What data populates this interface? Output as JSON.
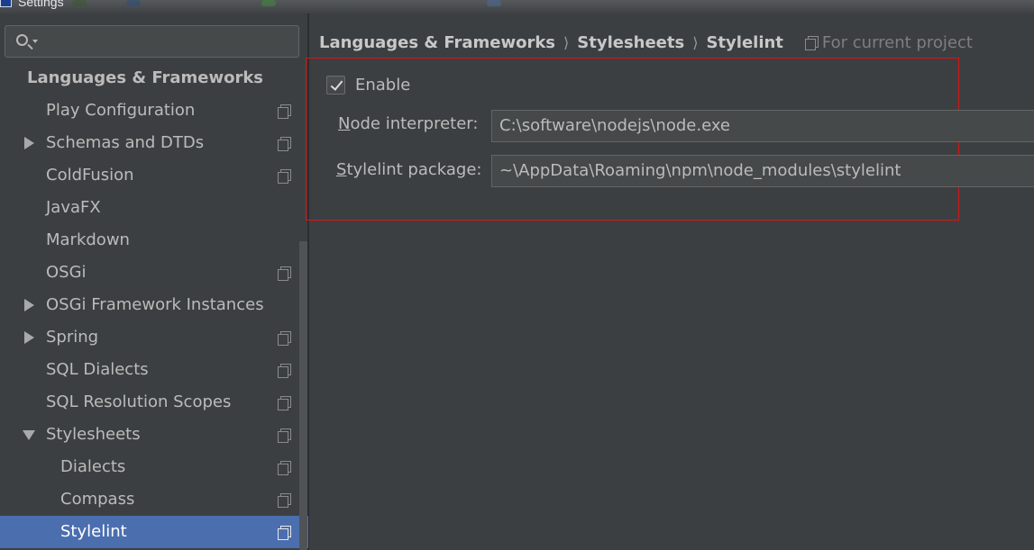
{
  "window": {
    "title": "Settings"
  },
  "search": {
    "value": ""
  },
  "sidebar": {
    "items": [
      {
        "label": "Languages & Frameworks",
        "arrow": "none",
        "project_icon": false
      },
      {
        "label": "Play Configuration",
        "arrow": "none",
        "project_icon": true
      },
      {
        "label": "Schemas and DTDs",
        "arrow": "right",
        "project_icon": true
      },
      {
        "label": "ColdFusion",
        "arrow": "none",
        "project_icon": true
      },
      {
        "label": "JavaFX",
        "arrow": "none",
        "project_icon": false
      },
      {
        "label": "Markdown",
        "arrow": "none",
        "project_icon": false
      },
      {
        "label": "OSGi",
        "arrow": "none",
        "project_icon": true
      },
      {
        "label": "OSGi Framework Instances",
        "arrow": "right",
        "project_icon": false
      },
      {
        "label": "Spring",
        "arrow": "right",
        "project_icon": true
      },
      {
        "label": "SQL Dialects",
        "arrow": "none",
        "project_icon": true
      },
      {
        "label": "SQL Resolution Scopes",
        "arrow": "none",
        "project_icon": true
      },
      {
        "label": "Stylesheets",
        "arrow": "down",
        "project_icon": true
      },
      {
        "label": "Dialects",
        "arrow": "none",
        "project_icon": true
      },
      {
        "label": "Compass",
        "arrow": "none",
        "project_icon": true
      },
      {
        "label": "Stylelint",
        "arrow": "none",
        "project_icon": true,
        "selected": true
      }
    ]
  },
  "breadcrumb": {
    "items": [
      "Languages & Frameworks",
      "Stylesheets",
      "Stylelint"
    ],
    "separator": "⟩",
    "scope_label": "For current project"
  },
  "form": {
    "enable_label": "Enable",
    "enable_checked": true,
    "node_interpreter": {
      "mnemonic": "N",
      "label_rest": "ode interpreter:",
      "value": "C:\\software\\nodejs\\node.exe"
    },
    "stylelint_package": {
      "mnemonic": "S",
      "label_rest": "tylelint package:",
      "value": "~\\AppData\\Roaming\\npm\\node_modules\\stylelint"
    }
  },
  "colors": {
    "selection": "#4b6eaf",
    "panel_bg": "#3c3f41",
    "highlight_border": "#d01818"
  },
  "icons": {
    "search": "search-icon",
    "project_scope": "project-scope-icon",
    "expand": "chevron-right-icon",
    "collapse": "chevron-down-icon"
  }
}
